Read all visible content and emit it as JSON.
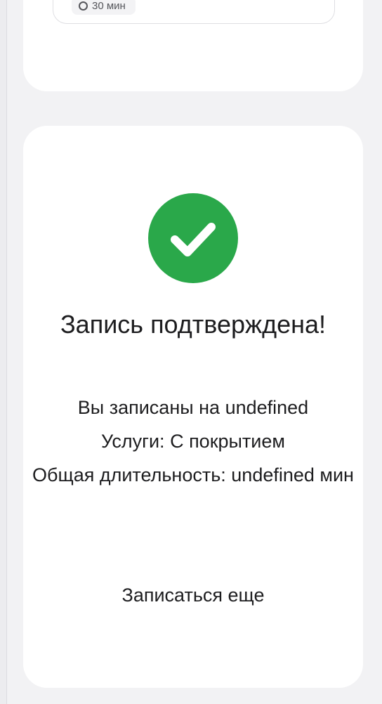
{
  "previous_card": {
    "duration_chip": "30 мин"
  },
  "confirmation": {
    "title": "Запись подтверждена!",
    "details": {
      "booked_for": "Вы записаны на undefined",
      "services": "Услуги: С покрытием",
      "total_duration": "Общая длительность: undefined мин"
    },
    "book_again_label": "Записаться еще",
    "icon": "check-circle-icon",
    "accent_color": "#2aa84a"
  }
}
